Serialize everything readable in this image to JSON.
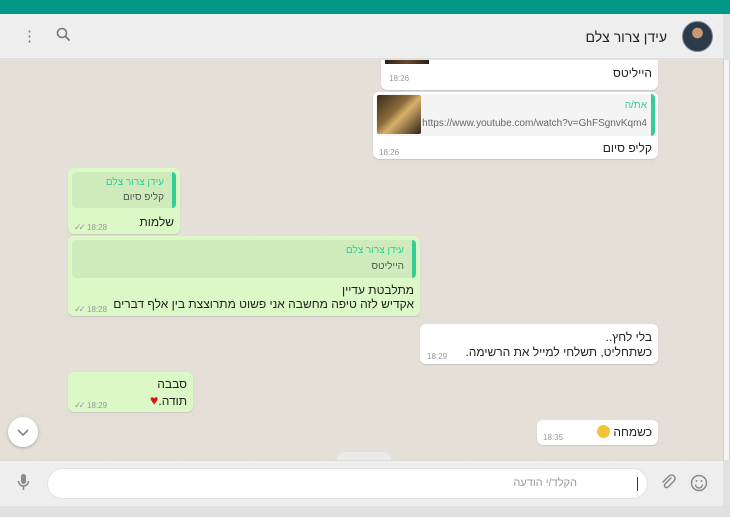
{
  "header": {
    "contact_name": "עידן צרור צלם",
    "menu_icon": "more-vert-icon",
    "search_icon": "search-icon"
  },
  "messages": [
    {
      "id": "m1",
      "direction": "in",
      "text": "הייליטס",
      "time": "18:26"
    },
    {
      "id": "m2",
      "direction": "in",
      "link_title": "את/ה",
      "link_url": "https://www.youtube.com/watch?v=GhFSgnvKqm4",
      "text": "קליפ סיום",
      "time": "18:26"
    },
    {
      "id": "m3",
      "direction": "out",
      "quote_author": "עידן צרור צלם",
      "quote_text": "קליפ סיום",
      "text": "שלמות",
      "time": "18:28"
    },
    {
      "id": "m4",
      "direction": "out",
      "quote_author": "עידן צרור צלם",
      "quote_text": "הייליטס",
      "line1": "מתלבטת עדיין",
      "line2": "אקדיש לזה טיפה מחשבה אני פשוט מתרוצצת בין אלף דברים",
      "time": "18:28"
    },
    {
      "id": "m5",
      "direction": "in",
      "line1": "בלי לחץ..",
      "line2": "כשתחליט, תשלחי למייל את הרשימה.",
      "time": "18:29"
    },
    {
      "id": "m6",
      "direction": "out",
      "line1": "סבבה",
      "line2": "תודה.",
      "time": "18:29"
    },
    {
      "id": "m7",
      "direction": "in",
      "text": "כשמחה",
      "time": "18:35"
    }
  ],
  "composer": {
    "placeholder": "הקלד/י הודעה"
  },
  "colors": {
    "accent": "#009688",
    "outgoing_bubble": "#dcf8c6",
    "incoming_bubble": "#ffffff",
    "quote_bar": "#35cd96"
  }
}
